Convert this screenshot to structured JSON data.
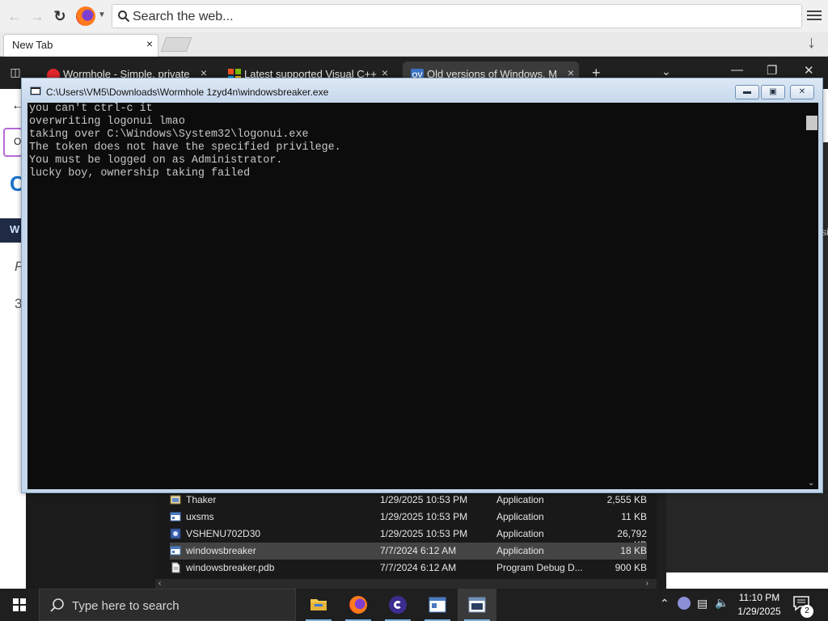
{
  "firefox": {
    "search_placeholder": "Search the web...",
    "tab_label": "New Tab",
    "tab_close": "×"
  },
  "edge": {
    "tabs": [
      {
        "label": "Wormhole - Simple, private file",
        "favicon_color": "#e0262a"
      },
      {
        "label": "Latest supported Visual C++ Re",
        "favicon_color": "#f25022"
      },
      {
        "label": "Old versions of Windows, Mac",
        "favicon_color": "#3b73c4",
        "favicon_text": "OV"
      }
    ],
    "tab_close": "×",
    "new_tab": "+",
    "sidebar": {
      "tab_letter": "O",
      "brand_letter": "C",
      "bar_letter": "W",
      "p_glyph": "F",
      "digit": "3"
    },
    "right_edge_text": "si"
  },
  "console": {
    "title": "C:\\Users\\VM5\\Downloads\\Wormhole 1zyd4n\\windowsbreaker.exe",
    "lines": [
      "you can't ctrl-c it",
      "overwriting logonui lmao",
      "taking over C:\\Windows\\System32\\logonui.exe",
      "The token does not have the specified privilege.",
      "You must be logged on as Administrator.",
      "lucky boy, ownership taking failed"
    ]
  },
  "explorer": {
    "rows": [
      {
        "name": "Thaker",
        "date": "1/29/2025 10:53 PM",
        "type": "Application",
        "size": "2,555 KB",
        "selected": false
      },
      {
        "name": "uxsms",
        "date": "1/29/2025 10:53 PM",
        "type": "Application",
        "size": "11 KB",
        "selected": false
      },
      {
        "name": "VSHENU702D30",
        "date": "1/29/2025 10:53 PM",
        "type": "Application",
        "size": "26,792 KB",
        "selected": false
      },
      {
        "name": "windowsbreaker",
        "date": "7/7/2024 6:12 AM",
        "type": "Application",
        "size": "18 KB",
        "selected": true
      },
      {
        "name": "windowsbreaker.pdb",
        "date": "7/7/2024 6:12 AM",
        "type": "Program Debug D...",
        "size": "900 KB",
        "selected": false
      }
    ]
  },
  "taskbar": {
    "search_placeholder": "Type here to search",
    "time": "11:10 PM",
    "date": "1/29/2025",
    "notification_count": "2"
  },
  "colors": {
    "taskbar_bg": "#1f1f1f",
    "console_bg": "#0c0c0c",
    "console_text": "#c8c8c8",
    "console_frame": "#c3d6ea",
    "edge_tabs_bg": "#202020"
  }
}
